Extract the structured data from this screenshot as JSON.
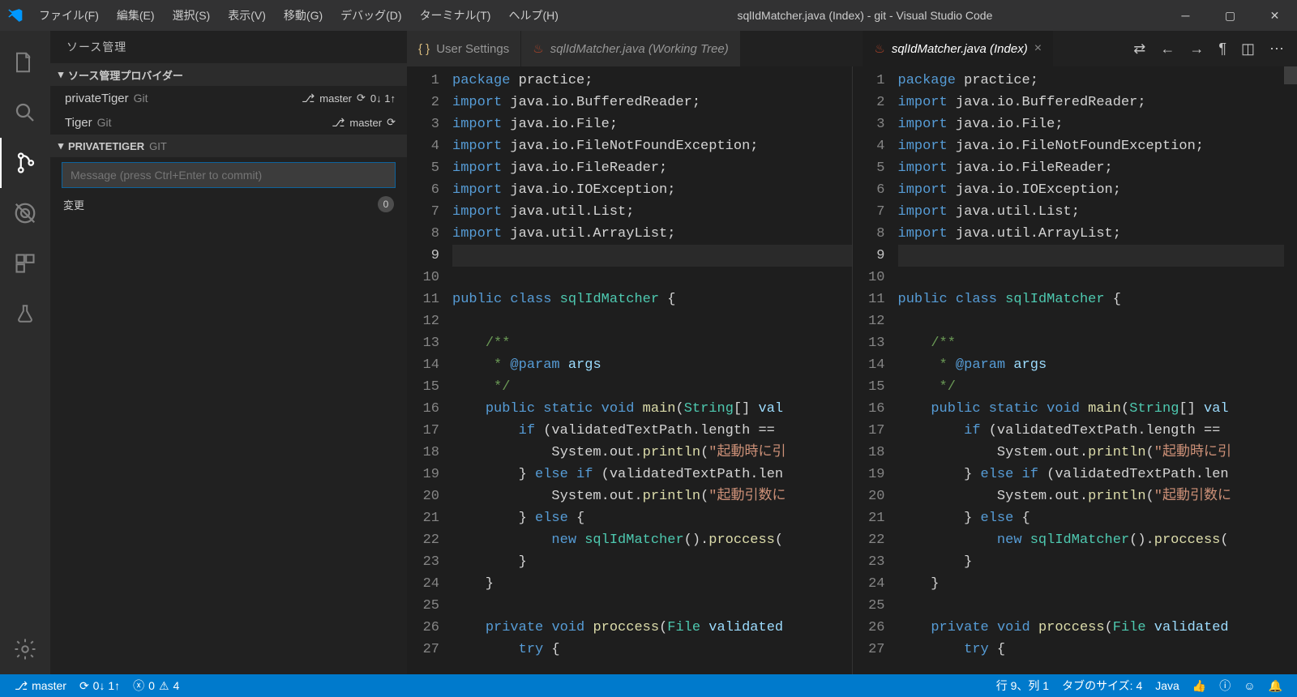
{
  "window": {
    "title": "sqlIdMatcher.java (Index) - git - Visual Studio Code"
  },
  "menus": {
    "file": "ファイル(F)",
    "edit": "編集(E)",
    "select": "選択(S)",
    "view": "表示(V)",
    "go": "移動(G)",
    "debug": "デバッグ(D)",
    "terminal": "ターミナル(T)",
    "help": "ヘルプ(H)"
  },
  "sidebar": {
    "header": "ソース管理",
    "providers_label": "ソース管理プロバイダー",
    "rows": [
      {
        "name": "privateTiger",
        "provider": "Git",
        "branch": "master",
        "sync": "0↓ 1↑"
      },
      {
        "name": "Tiger",
        "provider": "Git",
        "branch": "master",
        "sync": ""
      }
    ],
    "repo_header": "PRIVATETIGER",
    "repo_provider": "GIT",
    "commit_placeholder": "Message (press Ctrl+Enter to commit)",
    "changes_label": "変更",
    "changes_count": "0"
  },
  "tabs": {
    "left": [
      {
        "label": "User Settings",
        "icon": "settings"
      },
      {
        "label": "sqlIdMatcher.java (Working Tree)",
        "icon": "java"
      }
    ],
    "right": [
      {
        "label": "sqlIdMatcher.java (Index)",
        "icon": "java",
        "active": true
      }
    ]
  },
  "code": {
    "lines": [
      {
        "n": 1,
        "tokens": [
          [
            "kw",
            "package"
          ],
          [
            "def",
            " practice;"
          ]
        ]
      },
      {
        "n": 2,
        "tokens": [
          [
            "kw",
            "import"
          ],
          [
            "def",
            " java.io.BufferedReader;"
          ]
        ]
      },
      {
        "n": 3,
        "tokens": [
          [
            "kw",
            "import"
          ],
          [
            "def",
            " java.io.File;"
          ]
        ]
      },
      {
        "n": 4,
        "tokens": [
          [
            "kw",
            "import"
          ],
          [
            "def",
            " java.io.FileNotFoundException;"
          ]
        ]
      },
      {
        "n": 5,
        "tokens": [
          [
            "kw",
            "import"
          ],
          [
            "def",
            " java.io.FileReader;"
          ]
        ]
      },
      {
        "n": 6,
        "tokens": [
          [
            "kw",
            "import"
          ],
          [
            "def",
            " java.io.IOException;"
          ]
        ]
      },
      {
        "n": 7,
        "tokens": [
          [
            "kw",
            "import"
          ],
          [
            "def",
            " java.util.List;"
          ]
        ]
      },
      {
        "n": 8,
        "tokens": [
          [
            "kw",
            "import"
          ],
          [
            "def",
            " java.util.ArrayList;"
          ]
        ]
      },
      {
        "n": 9,
        "tokens": [],
        "hl": true
      },
      {
        "n": 10,
        "tokens": []
      },
      {
        "n": 11,
        "tokens": [
          [
            "kw",
            "public"
          ],
          [
            "def",
            " "
          ],
          [
            "kw",
            "class"
          ],
          [
            "def",
            " "
          ],
          [
            "ty",
            "sqlIdMatcher"
          ],
          [
            "def",
            " {"
          ]
        ]
      },
      {
        "n": 12,
        "tokens": []
      },
      {
        "n": 13,
        "tokens": [
          [
            "def",
            "    "
          ],
          [
            "cm",
            "/**"
          ]
        ]
      },
      {
        "n": 14,
        "tokens": [
          [
            "def",
            "     "
          ],
          [
            "cm",
            "* "
          ],
          [
            "kw",
            "@param"
          ],
          [
            "def",
            " "
          ],
          [
            "vr",
            "args"
          ]
        ]
      },
      {
        "n": 15,
        "tokens": [
          [
            "def",
            "     "
          ],
          [
            "cm",
            "*/"
          ]
        ]
      },
      {
        "n": 16,
        "tokens": [
          [
            "def",
            "    "
          ],
          [
            "kw",
            "public"
          ],
          [
            "def",
            " "
          ],
          [
            "kw",
            "static"
          ],
          [
            "def",
            " "
          ],
          [
            "kw",
            "void"
          ],
          [
            "def",
            " "
          ],
          [
            "fn",
            "main"
          ],
          [
            "def",
            "("
          ],
          [
            "ty",
            "String"
          ],
          [
            "def",
            "[] "
          ],
          [
            "vr",
            "val"
          ]
        ]
      },
      {
        "n": 17,
        "tokens": [
          [
            "def",
            "        "
          ],
          [
            "kw",
            "if"
          ],
          [
            "def",
            " (validatedTextPath.length == "
          ]
        ]
      },
      {
        "n": 18,
        "tokens": [
          [
            "def",
            "            System.out."
          ],
          [
            "fn",
            "println"
          ],
          [
            "def",
            "("
          ],
          [
            "st",
            "\"起動時に引"
          ]
        ]
      },
      {
        "n": 19,
        "tokens": [
          [
            "def",
            "        } "
          ],
          [
            "kw",
            "else"
          ],
          [
            "def",
            " "
          ],
          [
            "kw",
            "if"
          ],
          [
            "def",
            " (validatedTextPath.len"
          ]
        ]
      },
      {
        "n": 20,
        "tokens": [
          [
            "def",
            "            System.out."
          ],
          [
            "fn",
            "println"
          ],
          [
            "def",
            "("
          ],
          [
            "st",
            "\"起動引数に"
          ]
        ]
      },
      {
        "n": 21,
        "tokens": [
          [
            "def",
            "        } "
          ],
          [
            "kw",
            "else"
          ],
          [
            "def",
            " {"
          ]
        ]
      },
      {
        "n": 22,
        "tokens": [
          [
            "def",
            "            "
          ],
          [
            "kw",
            "new"
          ],
          [
            "def",
            " "
          ],
          [
            "ty",
            "sqlIdMatcher"
          ],
          [
            "def",
            "()."
          ],
          [
            "fn",
            "proccess"
          ],
          [
            "def",
            "("
          ]
        ]
      },
      {
        "n": 23,
        "tokens": [
          [
            "def",
            "        }"
          ]
        ]
      },
      {
        "n": 24,
        "tokens": [
          [
            "def",
            "    }"
          ]
        ]
      },
      {
        "n": 25,
        "tokens": []
      },
      {
        "n": 26,
        "tokens": [
          [
            "def",
            "    "
          ],
          [
            "kw",
            "private"
          ],
          [
            "def",
            " "
          ],
          [
            "kw",
            "void"
          ],
          [
            "def",
            " "
          ],
          [
            "fn",
            "proccess"
          ],
          [
            "def",
            "("
          ],
          [
            "ty",
            "File"
          ],
          [
            "def",
            " "
          ],
          [
            "vr",
            "validated"
          ]
        ]
      },
      {
        "n": 27,
        "tokens": [
          [
            "def",
            "        "
          ],
          [
            "kw",
            "try"
          ],
          [
            "def",
            " {"
          ]
        ]
      }
    ]
  },
  "status": {
    "branch": "master",
    "sync": "0↓ 1↑",
    "errors": "0",
    "warnings": "4",
    "cursor": "行 9、列 1",
    "tabsize": "タブのサイズ: 4",
    "lang": "Java"
  }
}
